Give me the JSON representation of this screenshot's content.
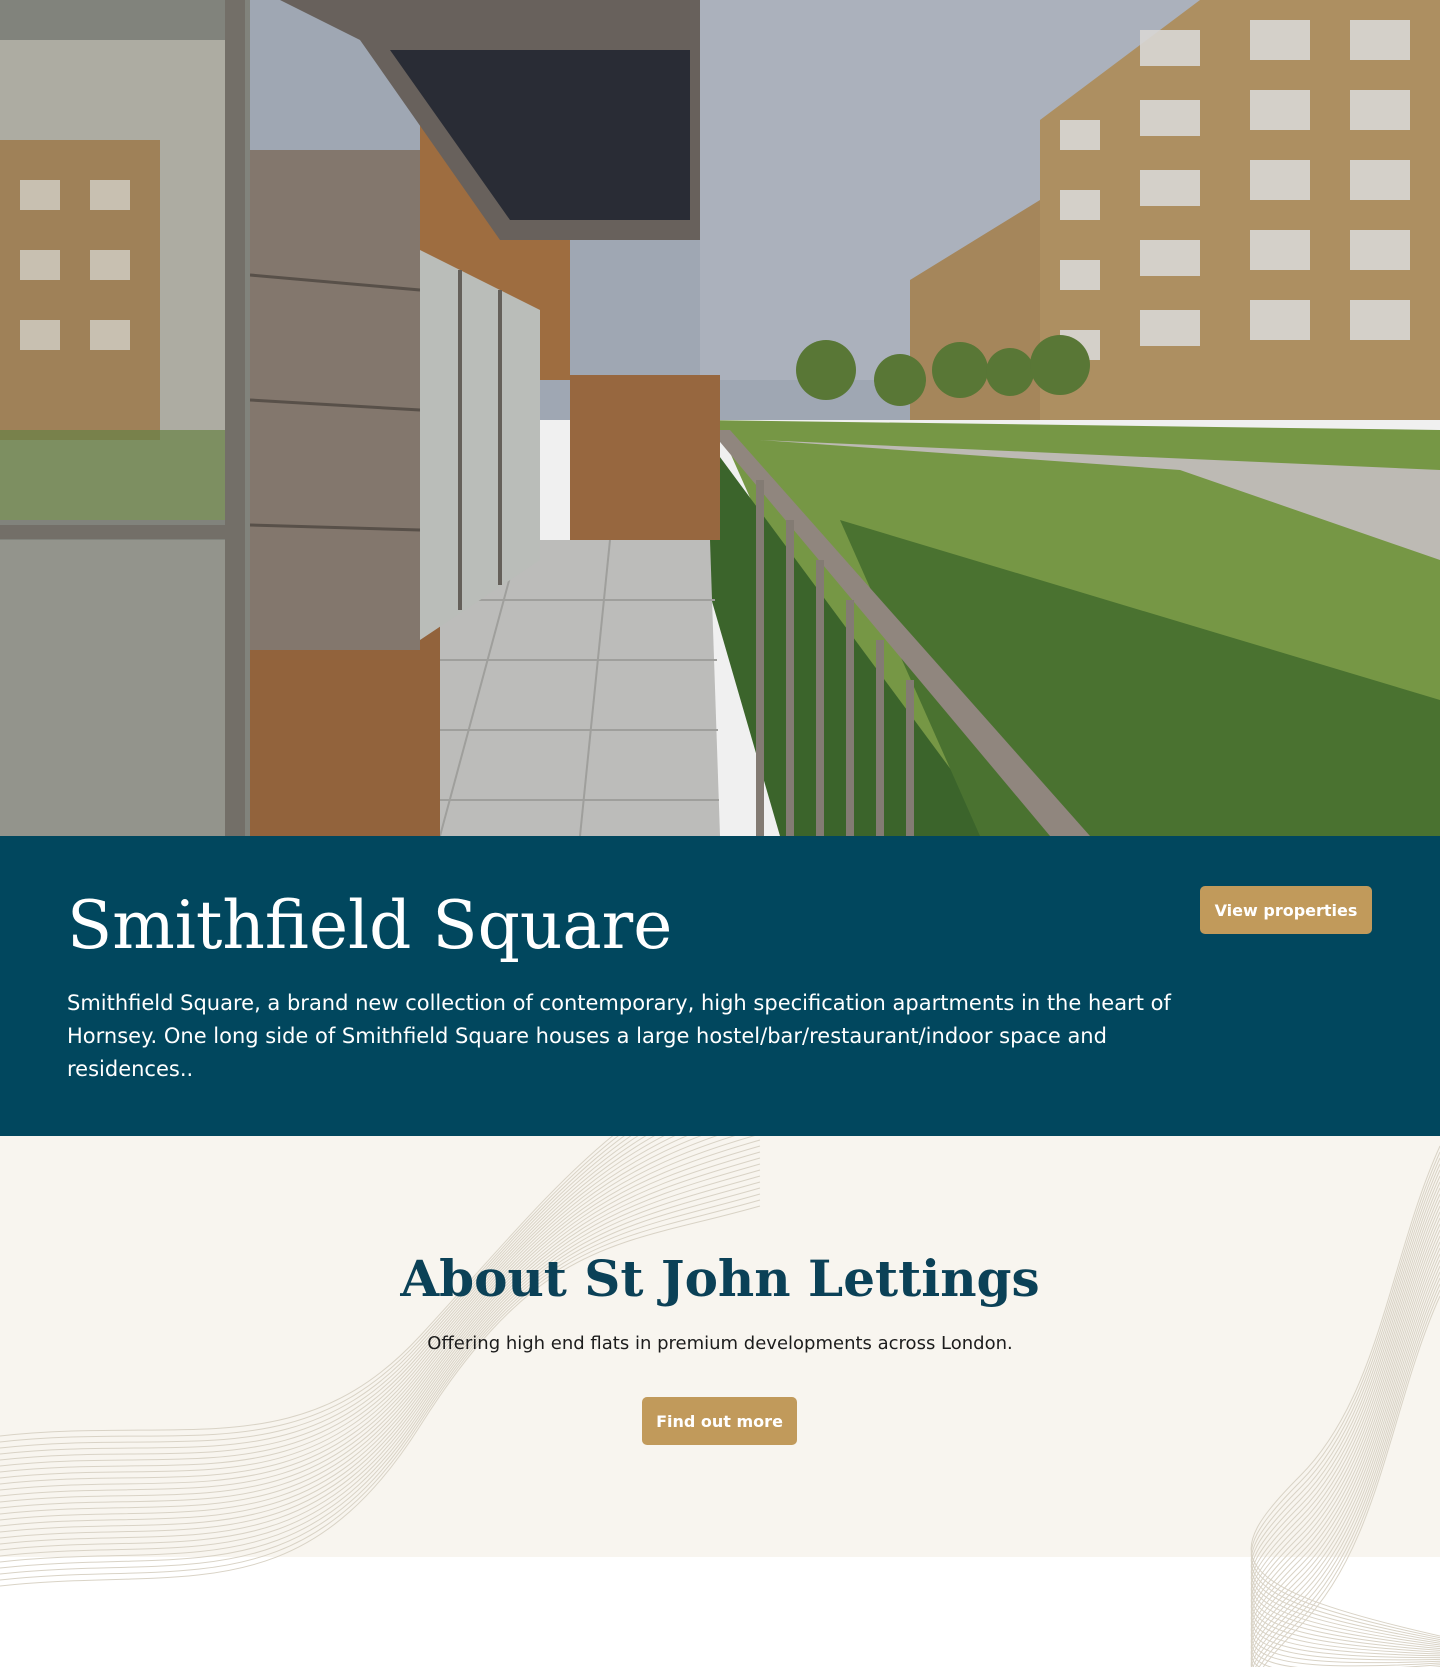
{
  "hero": {
    "image_description": "Apartment building terrace with brick walls, paved patio, railing and landscaped lawn"
  },
  "development": {
    "title": "Smithfield Square",
    "description": "Smithfield Square, a brand new collection of contemporary, high specification apartments in the heart of Hornsey. One long side of Smithfield Square houses a large hostel/bar/restaurant/indoor space and residences..",
    "cta_label": "View properties",
    "background_color": "#01475e"
  },
  "about": {
    "title": "About St John Lettings",
    "subtitle": "Offering high end flats in premium developments across London.",
    "cta_label": "Find out more",
    "background_color": "#f8f5ef"
  },
  "colors": {
    "accent": "#c19a5b",
    "heading": "#0b4157"
  }
}
